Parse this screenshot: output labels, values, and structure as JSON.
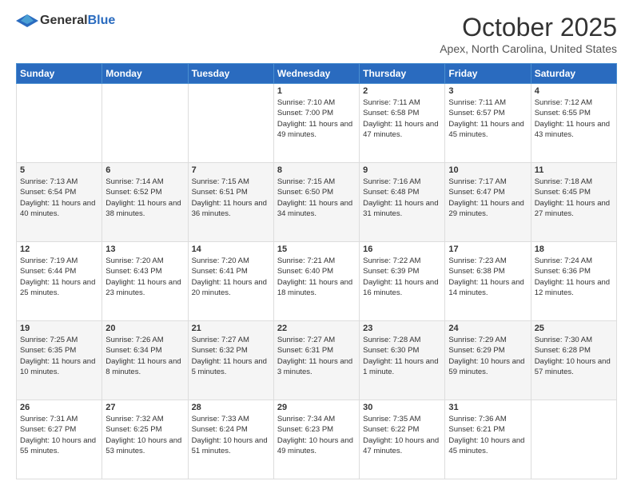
{
  "header": {
    "logo_general": "General",
    "logo_blue": "Blue",
    "month_title": "October 2025",
    "location": "Apex, North Carolina, United States"
  },
  "days_of_week": [
    "Sunday",
    "Monday",
    "Tuesday",
    "Wednesday",
    "Thursday",
    "Friday",
    "Saturday"
  ],
  "weeks": [
    [
      {
        "day": "",
        "info": ""
      },
      {
        "day": "",
        "info": ""
      },
      {
        "day": "",
        "info": ""
      },
      {
        "day": "1",
        "info": "Sunrise: 7:10 AM\nSunset: 7:00 PM\nDaylight: 11 hours and 49 minutes."
      },
      {
        "day": "2",
        "info": "Sunrise: 7:11 AM\nSunset: 6:58 PM\nDaylight: 11 hours and 47 minutes."
      },
      {
        "day": "3",
        "info": "Sunrise: 7:11 AM\nSunset: 6:57 PM\nDaylight: 11 hours and 45 minutes."
      },
      {
        "day": "4",
        "info": "Sunrise: 7:12 AM\nSunset: 6:55 PM\nDaylight: 11 hours and 43 minutes."
      }
    ],
    [
      {
        "day": "5",
        "info": "Sunrise: 7:13 AM\nSunset: 6:54 PM\nDaylight: 11 hours and 40 minutes."
      },
      {
        "day": "6",
        "info": "Sunrise: 7:14 AM\nSunset: 6:52 PM\nDaylight: 11 hours and 38 minutes."
      },
      {
        "day": "7",
        "info": "Sunrise: 7:15 AM\nSunset: 6:51 PM\nDaylight: 11 hours and 36 minutes."
      },
      {
        "day": "8",
        "info": "Sunrise: 7:15 AM\nSunset: 6:50 PM\nDaylight: 11 hours and 34 minutes."
      },
      {
        "day": "9",
        "info": "Sunrise: 7:16 AM\nSunset: 6:48 PM\nDaylight: 11 hours and 31 minutes."
      },
      {
        "day": "10",
        "info": "Sunrise: 7:17 AM\nSunset: 6:47 PM\nDaylight: 11 hours and 29 minutes."
      },
      {
        "day": "11",
        "info": "Sunrise: 7:18 AM\nSunset: 6:45 PM\nDaylight: 11 hours and 27 minutes."
      }
    ],
    [
      {
        "day": "12",
        "info": "Sunrise: 7:19 AM\nSunset: 6:44 PM\nDaylight: 11 hours and 25 minutes."
      },
      {
        "day": "13",
        "info": "Sunrise: 7:20 AM\nSunset: 6:43 PM\nDaylight: 11 hours and 23 minutes."
      },
      {
        "day": "14",
        "info": "Sunrise: 7:20 AM\nSunset: 6:41 PM\nDaylight: 11 hours and 20 minutes."
      },
      {
        "day": "15",
        "info": "Sunrise: 7:21 AM\nSunset: 6:40 PM\nDaylight: 11 hours and 18 minutes."
      },
      {
        "day": "16",
        "info": "Sunrise: 7:22 AM\nSunset: 6:39 PM\nDaylight: 11 hours and 16 minutes."
      },
      {
        "day": "17",
        "info": "Sunrise: 7:23 AM\nSunset: 6:38 PM\nDaylight: 11 hours and 14 minutes."
      },
      {
        "day": "18",
        "info": "Sunrise: 7:24 AM\nSunset: 6:36 PM\nDaylight: 11 hours and 12 minutes."
      }
    ],
    [
      {
        "day": "19",
        "info": "Sunrise: 7:25 AM\nSunset: 6:35 PM\nDaylight: 11 hours and 10 minutes."
      },
      {
        "day": "20",
        "info": "Sunrise: 7:26 AM\nSunset: 6:34 PM\nDaylight: 11 hours and 8 minutes."
      },
      {
        "day": "21",
        "info": "Sunrise: 7:27 AM\nSunset: 6:32 PM\nDaylight: 11 hours and 5 minutes."
      },
      {
        "day": "22",
        "info": "Sunrise: 7:27 AM\nSunset: 6:31 PM\nDaylight: 11 hours and 3 minutes."
      },
      {
        "day": "23",
        "info": "Sunrise: 7:28 AM\nSunset: 6:30 PM\nDaylight: 11 hours and 1 minute."
      },
      {
        "day": "24",
        "info": "Sunrise: 7:29 AM\nSunset: 6:29 PM\nDaylight: 10 hours and 59 minutes."
      },
      {
        "day": "25",
        "info": "Sunrise: 7:30 AM\nSunset: 6:28 PM\nDaylight: 10 hours and 57 minutes."
      }
    ],
    [
      {
        "day": "26",
        "info": "Sunrise: 7:31 AM\nSunset: 6:27 PM\nDaylight: 10 hours and 55 minutes."
      },
      {
        "day": "27",
        "info": "Sunrise: 7:32 AM\nSunset: 6:25 PM\nDaylight: 10 hours and 53 minutes."
      },
      {
        "day": "28",
        "info": "Sunrise: 7:33 AM\nSunset: 6:24 PM\nDaylight: 10 hours and 51 minutes."
      },
      {
        "day": "29",
        "info": "Sunrise: 7:34 AM\nSunset: 6:23 PM\nDaylight: 10 hours and 49 minutes."
      },
      {
        "day": "30",
        "info": "Sunrise: 7:35 AM\nSunset: 6:22 PM\nDaylight: 10 hours and 47 minutes."
      },
      {
        "day": "31",
        "info": "Sunrise: 7:36 AM\nSunset: 6:21 PM\nDaylight: 10 hours and 45 minutes."
      },
      {
        "day": "",
        "info": ""
      }
    ]
  ]
}
